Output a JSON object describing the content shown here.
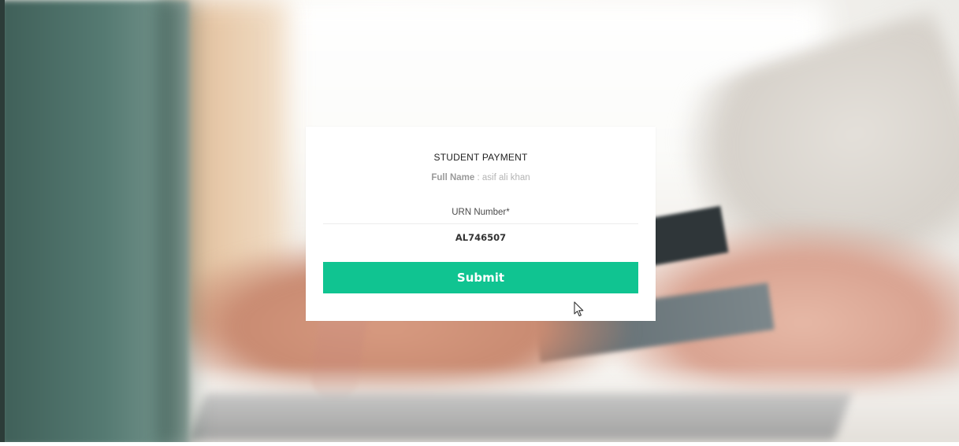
{
  "form": {
    "title": "STUDENT PAYMENT",
    "full_name_label": "Full Name",
    "full_name_separator": " : ",
    "full_name_value": "asif ali khan",
    "urn_label": "URN Number*",
    "urn_value": "AL746507",
    "submit_label": "Submit"
  },
  "colors": {
    "submit_button": "#10c491",
    "card_background": "#ffffff"
  },
  "icons": {
    "cursor": "mouse-pointer-icon"
  }
}
